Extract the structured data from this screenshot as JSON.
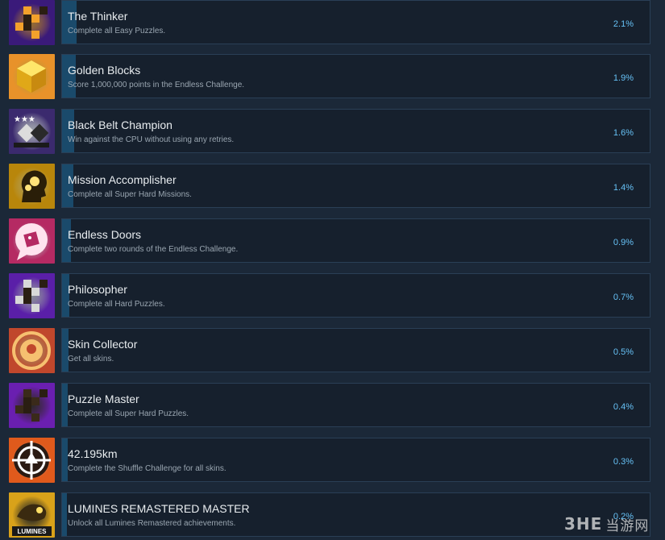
{
  "achievements": [
    {
      "title": "The Thinker",
      "description": "Complete all Easy Puzzles.",
      "percent": "2.1%",
      "progress": 0.021,
      "icon": "block-puzzle-icon",
      "colors": [
        "#3a1a7a",
        "#f3a12b"
      ]
    },
    {
      "title": "Golden Blocks",
      "description": "Score 1,000,000 points in the Endless Challenge.",
      "percent": "1.9%",
      "progress": 0.019,
      "icon": "golden-block-icon",
      "colors": [
        "#e8922a",
        "#ffd23a"
      ]
    },
    {
      "title": "Black Belt Champion",
      "description": "Win against the CPU without using any retries.",
      "percent": "1.6%",
      "progress": 0.016,
      "icon": "black-belt-icon",
      "colors": [
        "#3b2a6e",
        "#ffffff"
      ]
    },
    {
      "title": "Mission Accomplisher",
      "description": "Complete all Super Hard Missions.",
      "percent": "1.4%",
      "progress": 0.014,
      "icon": "head-gears-icon",
      "colors": [
        "#b8860b",
        "#ffe27a"
      ]
    },
    {
      "title": "Endless Doors",
      "description": "Complete two rounds of the Endless Challenge.",
      "percent": "0.9%",
      "progress": 0.009,
      "icon": "chat-bubble-block-icon",
      "colors": [
        "#b52a63",
        "#ffffff"
      ]
    },
    {
      "title": "Philosopher",
      "description": "Complete all Hard Puzzles.",
      "percent": "0.7%",
      "progress": 0.007,
      "icon": "block-puzzle-icon",
      "colors": [
        "#5a1fa8",
        "#d8d8d8"
      ]
    },
    {
      "title": "Skin Collector",
      "description": "Get all skins.",
      "percent": "0.5%",
      "progress": 0.005,
      "icon": "medal-emblem-icon",
      "colors": [
        "#c0472c",
        "#f6c070"
      ]
    },
    {
      "title": "Puzzle Master",
      "description": "Complete all Super Hard Puzzles.",
      "percent": "0.4%",
      "progress": 0.004,
      "icon": "block-puzzle-icon",
      "colors": [
        "#6a1fb0",
        "#3a2a1a"
      ]
    },
    {
      "title": "42.195km",
      "description": "Complete the Shuffle Challenge for all skins.",
      "percent": "0.3%",
      "progress": 0.003,
      "icon": "target-emblem-icon",
      "colors": [
        "#e05a1c",
        "#ffffff"
      ]
    },
    {
      "title": "LUMINES REMASTERED MASTER",
      "description": "Unlock all Lumines Remastered achievements.",
      "percent": "0.2%",
      "progress": 0.002,
      "icon": "lumines-logo-icon",
      "logo_text": "LUMINES",
      "colors": [
        "#d9a21a",
        "#1a1a1a"
      ]
    }
  ],
  "watermark": {
    "logo": "3HE",
    "text": "当游网"
  },
  "colors": {
    "background": "#1b2838",
    "panel": "#16202d",
    "border": "#2a3f56",
    "progress": "#1a4a6b",
    "percent": "#66c0f4"
  }
}
